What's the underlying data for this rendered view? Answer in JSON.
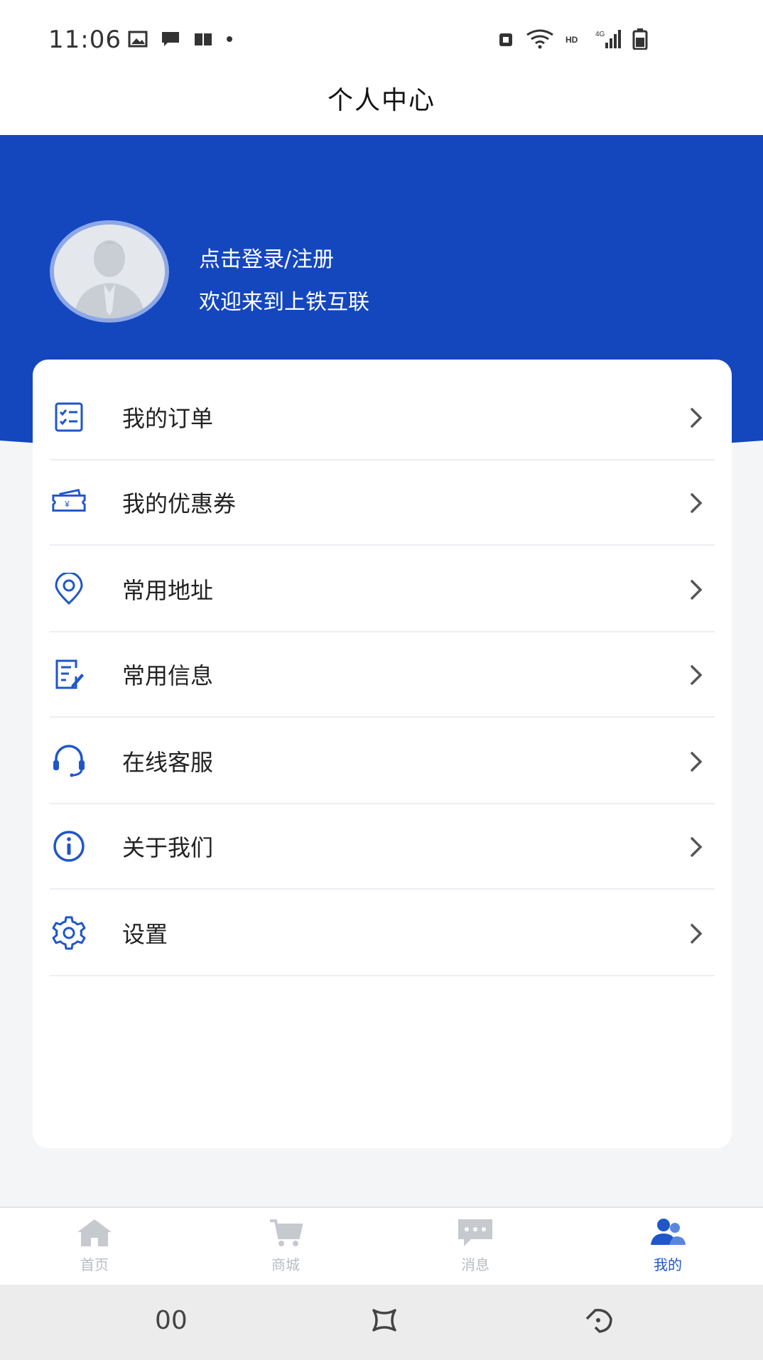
{
  "status_bar": {
    "time": "11:06",
    "left_icons": [
      "image-icon",
      "message-icon",
      "book-icon",
      "dot-icon"
    ],
    "right_icons": [
      "alarm-icon",
      "wifi-icon",
      "hd-icon",
      "signal-4g-icon",
      "battery-icon"
    ]
  },
  "header": {
    "title": "个人中心"
  },
  "profile": {
    "login_label": "点击登录/注册",
    "welcome_label": "欢迎来到上铁互联",
    "avatar_icon": "user-avatar-icon"
  },
  "menu": {
    "items": [
      {
        "label": "我的订单",
        "icon": "order-list-icon"
      },
      {
        "label": "我的优惠券",
        "icon": "coupon-icon"
      },
      {
        "label": "常用地址",
        "icon": "location-icon"
      },
      {
        "label": "常用信息",
        "icon": "info-edit-icon"
      },
      {
        "label": "在线客服",
        "icon": "headset-icon"
      },
      {
        "label": "关于我们",
        "icon": "info-circle-icon"
      },
      {
        "label": "设置",
        "icon": "gear-icon"
      }
    ]
  },
  "bottom_nav": {
    "items": [
      {
        "label": "首页",
        "icon": "home-icon",
        "active": false
      },
      {
        "label": "商城",
        "icon": "cart-icon",
        "active": false
      },
      {
        "label": "消息",
        "icon": "chat-icon",
        "active": false
      },
      {
        "label": "我的",
        "icon": "users-icon",
        "active": true
      }
    ]
  },
  "system_bar": {
    "left": "00",
    "center_icon": "home-shape-icon",
    "right_icon": "back-icon"
  },
  "colors": {
    "brand_blue": "#1447be",
    "icon_blue": "#1f56c9",
    "inactive_gray": "#b9bcc2"
  }
}
